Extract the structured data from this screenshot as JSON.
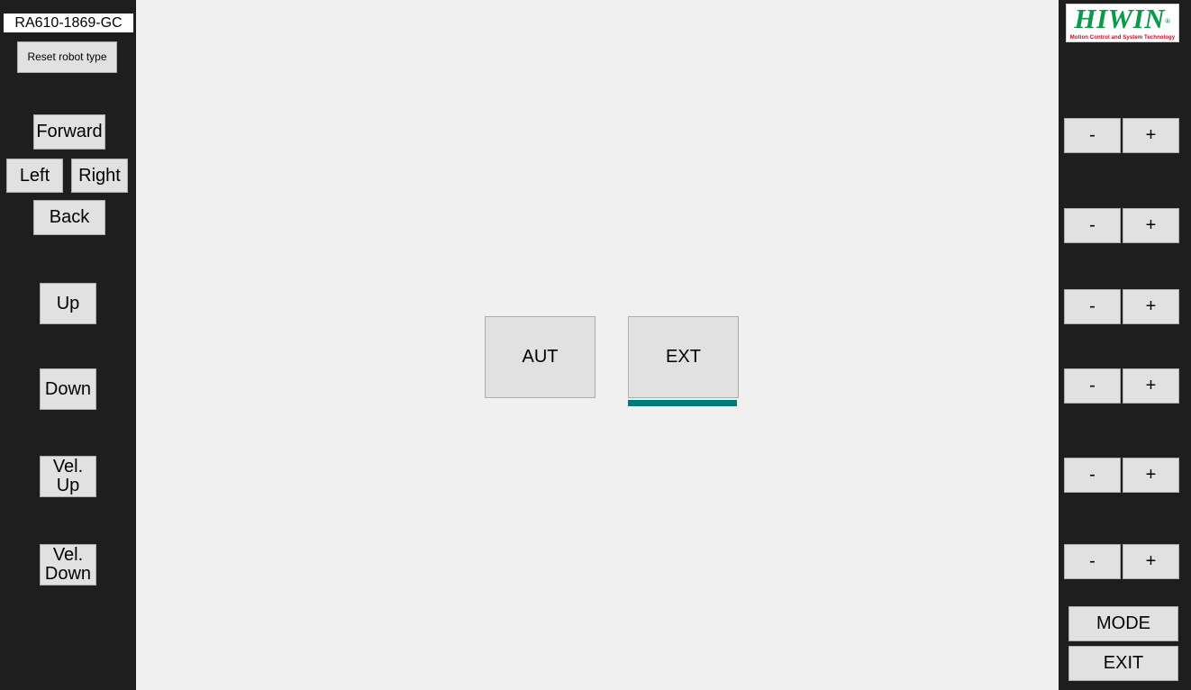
{
  "left_panel": {
    "robot_type": "RA610-1869-GC",
    "reset_label": "Reset robot type",
    "forward_label": "Forward",
    "left_label": "Left",
    "right_label": "Right",
    "back_label": "Back",
    "up_label": "Up",
    "down_label": "Down",
    "vel_up_line1": "Vel.",
    "vel_up_line2": "Up",
    "vel_down_line1": "Vel.",
    "vel_down_line2": "Down"
  },
  "main": {
    "aut_label": "AUT",
    "ext_label": "EXT",
    "selected_mode": "EXT",
    "selected_color": "#007b7b"
  },
  "right_panel": {
    "logo_text": "HIWIN",
    "logo_registered": "®",
    "logo_tagline": "Motion Control and System Technology",
    "steppers": [
      {
        "minus": "-",
        "plus": "+"
      },
      {
        "minus": "-",
        "plus": "+"
      },
      {
        "minus": "-",
        "plus": "+"
      },
      {
        "minus": "-",
        "plus": "+"
      },
      {
        "minus": "-",
        "plus": "+"
      },
      {
        "minus": "-",
        "plus": "+"
      }
    ],
    "mode_label": "MODE",
    "exit_label": "EXIT"
  }
}
